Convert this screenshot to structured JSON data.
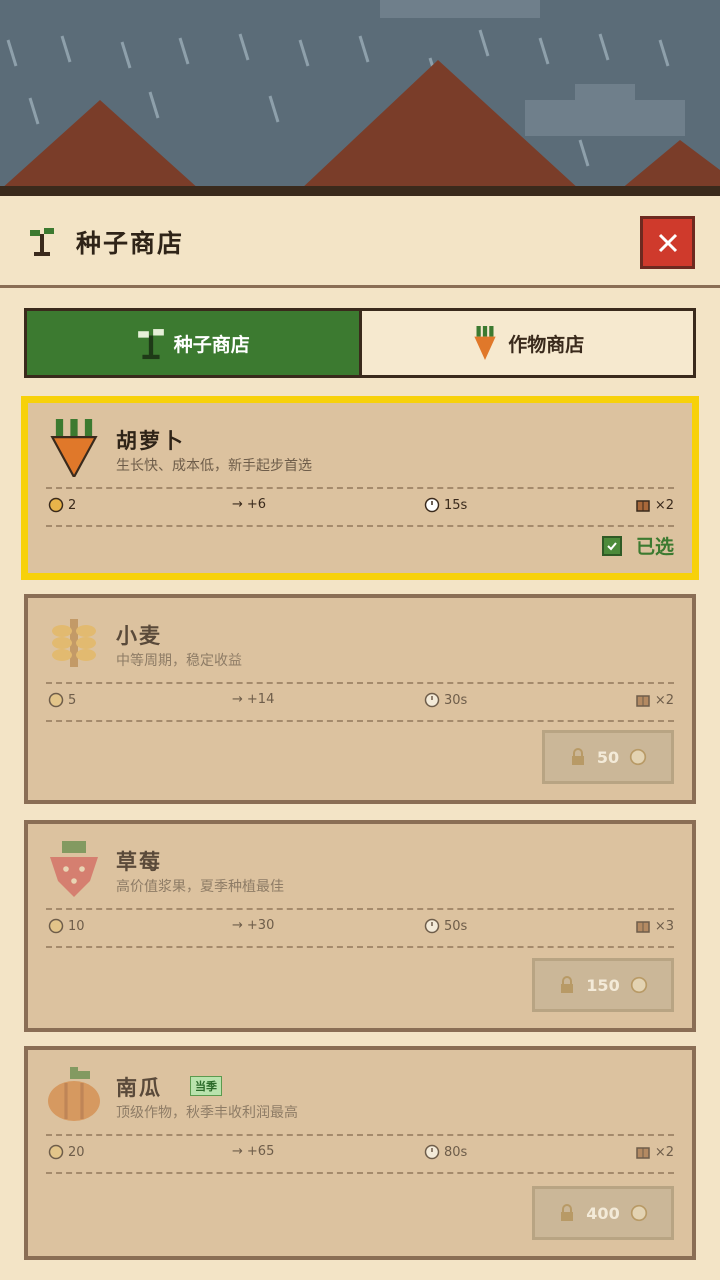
{
  "header": {
    "title": "种子商店",
    "icon": "sprout-icon",
    "close_icon": "close-icon"
  },
  "tabs": [
    {
      "label": "种子商店",
      "icon": "sprout-icon",
      "active": true
    },
    {
      "label": "作物商店",
      "icon": "carrot-icon",
      "active": false
    }
  ],
  "seeds": [
    {
      "name": "胡萝卜",
      "desc": "生长快、成本低，新手起步首选",
      "icon": "carrot-icon",
      "cost": "2",
      "profit": "+6",
      "time": "15s",
      "yield": "×2",
      "status_label": "已选"
    },
    {
      "name": "小麦",
      "desc": "中等周期，稳定收益",
      "icon": "wheat-icon",
      "cost": "5",
      "profit": "+14",
      "time": "30s",
      "yield": "×2",
      "price": "50"
    },
    {
      "name": "草莓",
      "desc": "高价值浆果，夏季种植最佳",
      "icon": "strawberry-icon",
      "cost": "10",
      "profit": "+30",
      "time": "50s",
      "yield": "×3",
      "price": "150"
    },
    {
      "name": "南瓜",
      "tag": "当季",
      "desc": "顶级作物，秋季丰收利润最高",
      "icon": "pumpkin-icon",
      "cost": "20",
      "profit": "+65",
      "time": "80s",
      "yield": "×2",
      "price": "400"
    }
  ],
  "colors": {
    "accent_green": "#3c7a30",
    "selected_border": "#f7d10a",
    "close_red": "#cf3a2c"
  }
}
